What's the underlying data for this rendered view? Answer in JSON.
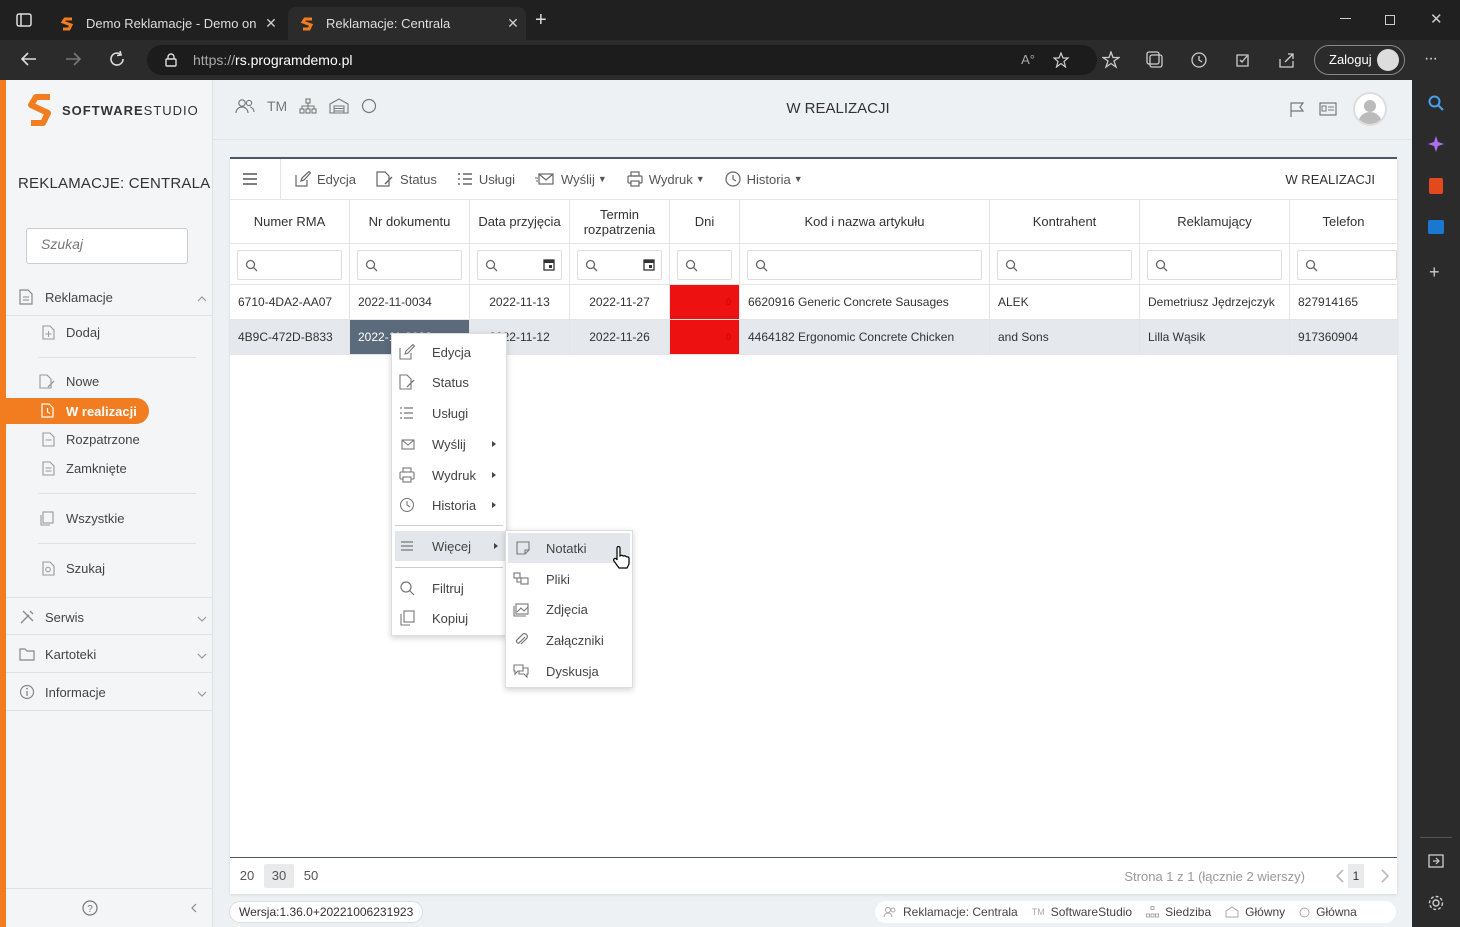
{
  "browser": {
    "tabs": [
      {
        "title": "Demo Reklamacje - Demo on lin"
      },
      {
        "title": "Reklamacje: Centrala"
      }
    ],
    "url_scheme": "https://",
    "url_host": "rs.programdemo.pl",
    "login_label": "Zaloguj"
  },
  "app": {
    "logo_bold": "SOFTWARE",
    "logo_light": "STUDIO",
    "name": "REKLAMACJE: CENTRALA",
    "search_placeholder": "Szukaj",
    "top_abbr": "TM",
    "page_title": "W REALIZACJI",
    "accent": "#f27d21"
  },
  "sidebar": {
    "reklamacje": "Reklamacje",
    "dodaj": "Dodaj",
    "nowe": "Nowe",
    "w_realizacji": "W realizacji",
    "rozpatrzone": "Rozpatrzone",
    "zamkniete": "Zamknięte",
    "wszystkie": "Wszystkie",
    "szukaj": "Szukaj",
    "serwis": "Serwis",
    "kartoteki": "Kartoteki",
    "informacje": "Informacje"
  },
  "toolbar": {
    "edycja": "Edycja",
    "status": "Status",
    "uslugi": "Usługi",
    "wyslij": "Wyślij",
    "wydruk": "Wydruk",
    "historia": "Historia",
    "title": "W REALIZACJI"
  },
  "table": {
    "headers": [
      "Numer RMA",
      "Nr dokumentu",
      "Data przyjęcia",
      "Termin rozpatrzenia",
      "Dni",
      "Kod i nazwa artykułu",
      "Kontrahent",
      "Reklamujący",
      "Telefon"
    ],
    "header_termin_1": "Termin",
    "header_termin_2": "rozpatrzenia",
    "rows": [
      [
        "6710-4DA2-AA07",
        "2022-11-0034",
        "2022-11-13",
        "2022-11-27",
        "0",
        "6620916 Generic Concrete Sausages",
        "ALEK",
        "Demetriusz Jędrzejczyk",
        "827914165"
      ],
      [
        "4B9C-472D-B833",
        "2022-11-0033",
        "2022-11-12",
        "2022-11-26",
        "0",
        "4464182 Ergonomic Concrete Chicken",
        "and Sons",
        "Lilla Wąsik",
        "917360904"
      ]
    ],
    "overdue_color": "#ee1111"
  },
  "pager": {
    "sizes": [
      "20",
      "30",
      "50"
    ],
    "info": "Strona 1 z 1 (łącznie 2 wierszy)",
    "page": "1"
  },
  "footer": {
    "version": "Wersja:1.36.0+20221006231923",
    "ctx1": "Reklamacje: Centrala",
    "ctx2": "SoftwareStudio",
    "ctx3": "Siedziba",
    "ctx4": "Główny",
    "ctx5": "Główna"
  },
  "context_menu": {
    "items": [
      "Edycja",
      "Status",
      "Usługi",
      "Wyślij",
      "Wydruk",
      "Historia",
      "Więcej",
      "Filtruj",
      "Kopiuj"
    ],
    "submenu": [
      "Notatki",
      "Pliki",
      "Zdjęcia",
      "Załączniki",
      "Dyskusja"
    ]
  }
}
